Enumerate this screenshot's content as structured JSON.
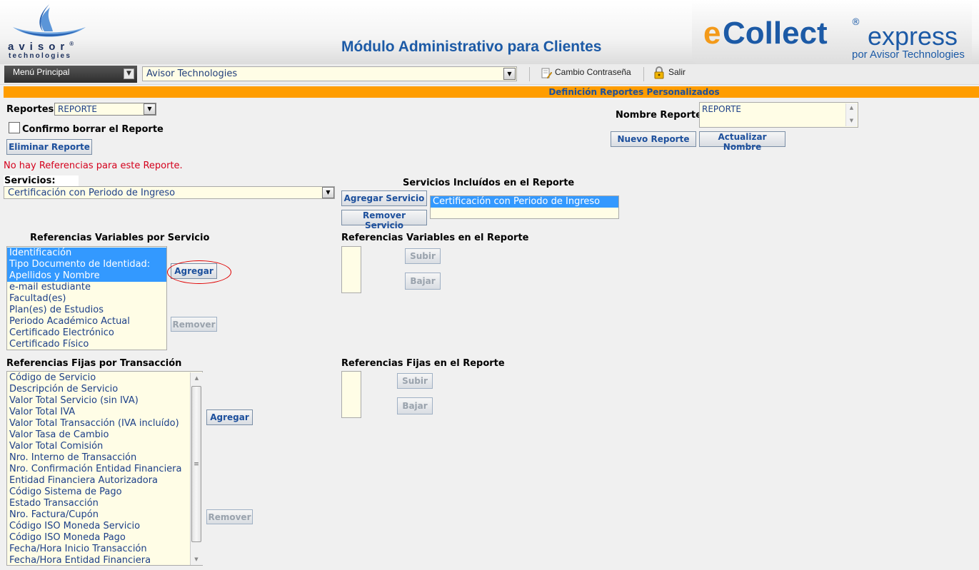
{
  "header": {
    "logo_word": "avisor",
    "logo_reg": "®",
    "logo_sub": "technologies",
    "title": "Módulo Administrativo para Clientes",
    "brand_e": "e",
    "brand_collect": "Collect",
    "brand_reg": "®",
    "brand_express": "express",
    "brand_tagline": "por Avisor Technologies"
  },
  "menubar": {
    "menu_label": "Menú Principal",
    "company_value": "Avisor Technologies",
    "change_password": "Cambio Contraseña",
    "logout": "Salir"
  },
  "section_title": "Definición Reportes Personalizados",
  "reportes": {
    "label": "Reportes:",
    "selected": "REPORTE",
    "confirm_label": "Confirmo borrar el Reporte",
    "delete_button": "Eliminar Reporte",
    "name_label": "Nombre Reporte:",
    "name_value": "REPORTE",
    "new_button": "Nuevo Reporte",
    "update_button": "Actualizar Nombre",
    "no_refs_message": "No hay Referencias para este Reporte."
  },
  "servicios": {
    "label": "Servicios:",
    "selected": "Certificación con Periodo de Ingreso",
    "included_title": "Servicios Incluídos en el Reporte",
    "add_button": "Agregar Servicio",
    "remove_button": "Remover Servicio",
    "included_items": [
      "Certificación con Periodo de Ingreso"
    ]
  },
  "ref_variables": {
    "title": "Referencias Variables por Servicio",
    "items": [
      {
        "label": "Identificación",
        "selected": true
      },
      {
        "label": "Tipo Documento de Identidad:",
        "selected": true
      },
      {
        "label": "Apellidos y Nombre",
        "selected": true
      },
      {
        "label": "e-mail estudiante",
        "selected": false
      },
      {
        "label": "Facultad(es)",
        "selected": false
      },
      {
        "label": "Plan(es) de Estudios",
        "selected": false
      },
      {
        "label": "Periodo Académico Actual",
        "selected": false
      },
      {
        "label": "Certificado Electrónico",
        "selected": false
      },
      {
        "label": "Certificado Físico",
        "selected": false
      }
    ],
    "add_button": "Agregar",
    "remove_button": "Remover",
    "report_title": "Referencias Variables en el Reporte",
    "up_button": "Subir",
    "down_button": "Bajar"
  },
  "ref_fijas": {
    "title": "Referencias Fijas por Transacción",
    "items": [
      "Código de Servicio",
      "Descripción de Servicio",
      "Valor Total Servicio (sin IVA)",
      "Valor Total IVA",
      "Valor Total Transacción (IVA incluído)",
      "Valor Tasa de Cambio",
      "Valor Total Comisión",
      "Nro. Interno de Transacción",
      "Nro. Confirmación Entidad Financiera",
      "Entidad Financiera Autorizadora",
      "Código Sistema de Pago",
      "Estado Transacción",
      "Nro. Factura/Cupón",
      "Código ISO Moneda Servicio",
      "Código ISO Moneda Pago",
      "Fecha/Hora Inicio Transacción",
      "Fecha/Hora Entidad Financiera"
    ],
    "add_button": "Agregar",
    "remove_button": "Remover",
    "report_title": "Referencias Fijas en el Reporte",
    "up_button": "Subir",
    "down_button": "Bajar"
  },
  "colors": {
    "accent_orange": "#ff9d00",
    "title_blue": "#1c5aa6",
    "selection_blue": "#3399ff",
    "error_red": "#d4001c",
    "list_background": "#fffde6"
  }
}
